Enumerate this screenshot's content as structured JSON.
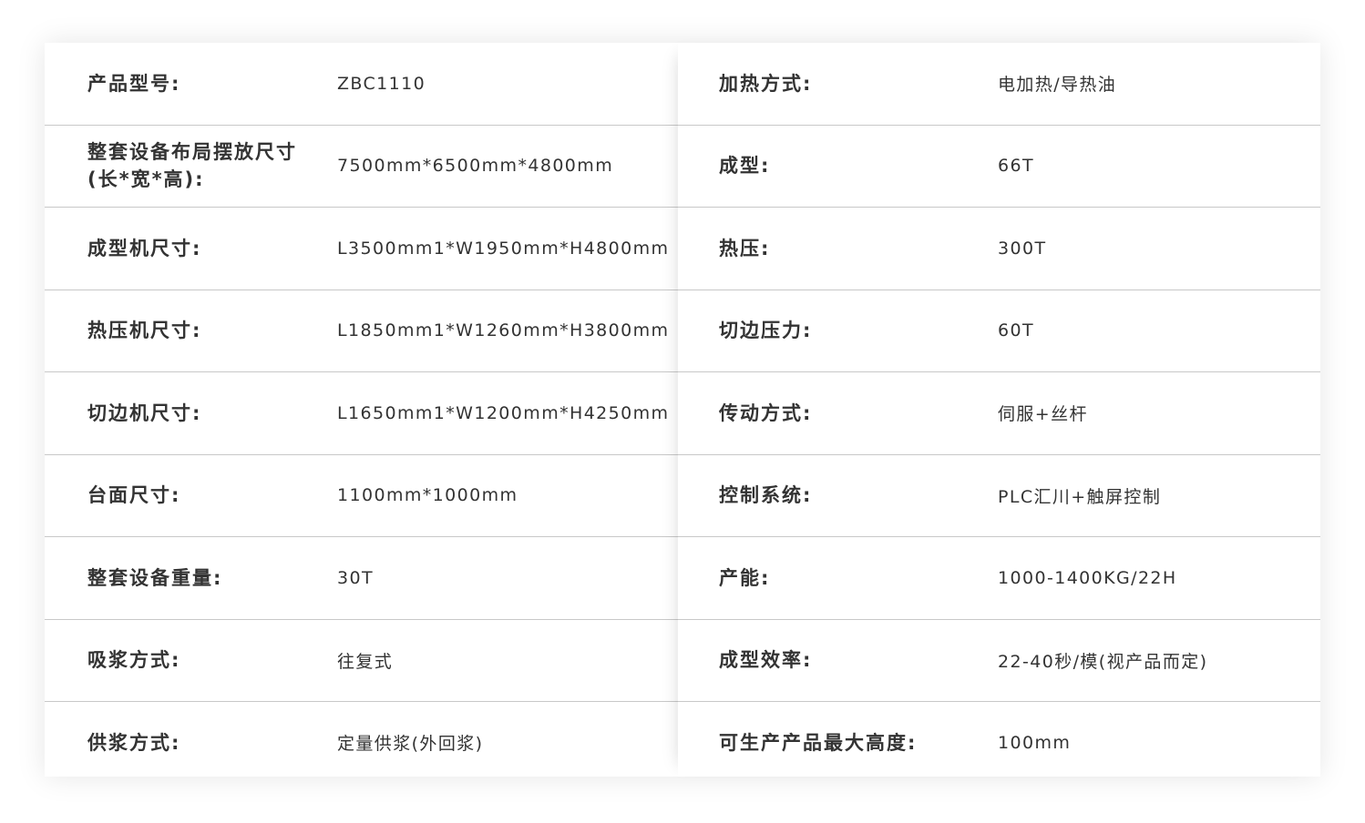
{
  "specs": {
    "left": [
      {
        "label": "产品型号:",
        "value": "ZBC1110"
      },
      {
        "label": "整套设备布局摆放尺寸(长*宽*高):",
        "value": "7500mm*6500mm*4800mm"
      },
      {
        "label": "成型机尺寸:",
        "value": "L3500mm1*W1950mm*H4800mm"
      },
      {
        "label": "热压机尺寸:",
        "value": "L1850mm1*W1260mm*H3800mm"
      },
      {
        "label": "切边机尺寸:",
        "value": "L1650mm1*W1200mm*H4250mm"
      },
      {
        "label": "台面尺寸:",
        "value": "1100mm*1000mm"
      },
      {
        "label": "整套设备重量:",
        "value": "30T"
      },
      {
        "label": "吸浆方式:",
        "value": "往复式"
      },
      {
        "label": "供浆方式:",
        "value": "定量供浆(外回浆)"
      }
    ],
    "right": [
      {
        "label": "加热方式:",
        "value": "电加热/导热油"
      },
      {
        "label": "成型:",
        "value": "66T"
      },
      {
        "label": "热压:",
        "value": "300T"
      },
      {
        "label": "切边压力:",
        "value": "60T"
      },
      {
        "label": "传动方式:",
        "value": "伺服+丝杆"
      },
      {
        "label": "控制系统:",
        "value": "PLC汇川+触屏控制"
      },
      {
        "label": "产能:",
        "value": "1000-1400KG/22H"
      },
      {
        "label": "成型效率:",
        "value": "22-40秒/模(视产品而定)"
      },
      {
        "label": "可生产产品最大高度:",
        "value": "100mm"
      }
    ]
  }
}
